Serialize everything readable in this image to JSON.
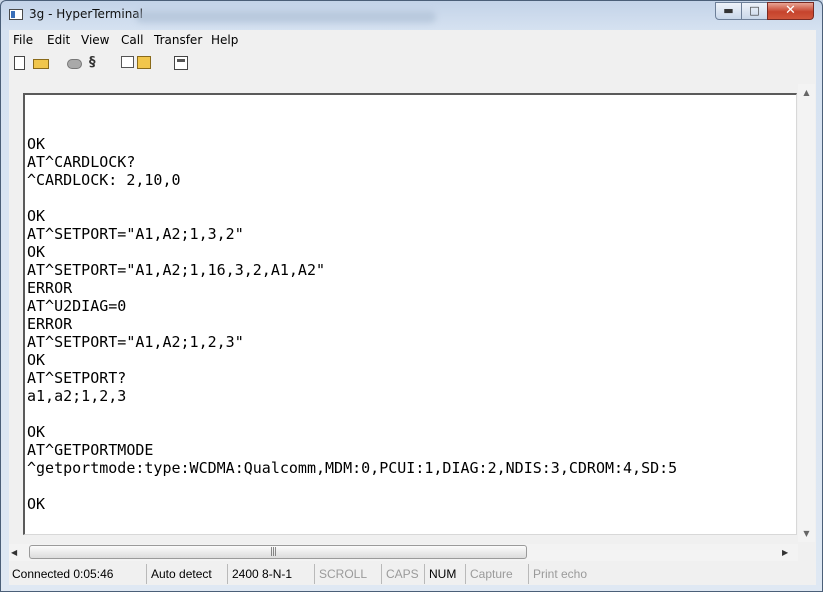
{
  "window": {
    "title": "3g - HyperTerminal",
    "minimize": "▬",
    "maximize": "□",
    "close": "✕"
  },
  "menu": [
    "File",
    "Edit",
    "View",
    "Call",
    "Transfer",
    "Help"
  ],
  "toolbar": {
    "icons": [
      "new-icon",
      "open-icon",
      "disconnect-icon",
      "dial-icon",
      "send-icon",
      "receive-icon",
      "properties-icon"
    ],
    "dial_glyph": "§"
  },
  "terminal": {
    "lines": [
      "",
      "OK",
      "AT^CARDLOCK?",
      "^CARDLOCK: 2,10,0",
      "",
      "OK",
      "AT^SETPORT=\"A1,A2;1,3,2\"",
      "OK",
      "AT^SETPORT=\"A1,A2;1,16,3,2,A1,A2\"",
      "ERROR",
      "AT^U2DIAG=0",
      "ERROR",
      "AT^SETPORT=\"A1,A2;1,2,3\"",
      "OK",
      "AT^SETPORT?",
      "a1,a2;1,2,3",
      "",
      "OK",
      "AT^GETPORTMODE",
      "^getportmode:type:WCDMA:Qualcomm,MDM:0,PCUI:1,DIAG:2,NDIS:3,CDROM:4,SD:5",
      "",
      "OK"
    ]
  },
  "scrollbars": {
    "up": "▲",
    "down": "▼",
    "left": "◀",
    "right": "▶",
    "grip": "|||"
  },
  "status": {
    "connected": "Connected 0:05:46",
    "detect": "Auto detect",
    "settings": "2400 8-N-1",
    "scroll": "SCROLL",
    "caps": "CAPS",
    "num": "NUM",
    "capture": "Capture",
    "print_echo": "Print echo"
  }
}
